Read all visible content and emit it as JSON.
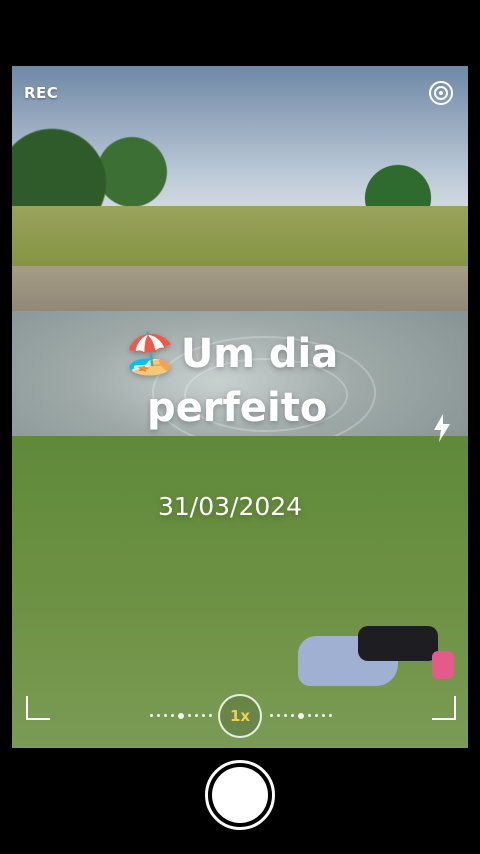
{
  "status": {
    "rec_label": "REC"
  },
  "overlay": {
    "title_line1": "Um dia",
    "title_line2": "perfeito",
    "emoji": "🏖️",
    "date": "31/03/2024"
  },
  "controls": {
    "zoom_label": "1x",
    "zoom_color": "#f1d04b"
  },
  "icons": {
    "top_right": "camera-lens-icon",
    "flash": "flash-icon"
  }
}
